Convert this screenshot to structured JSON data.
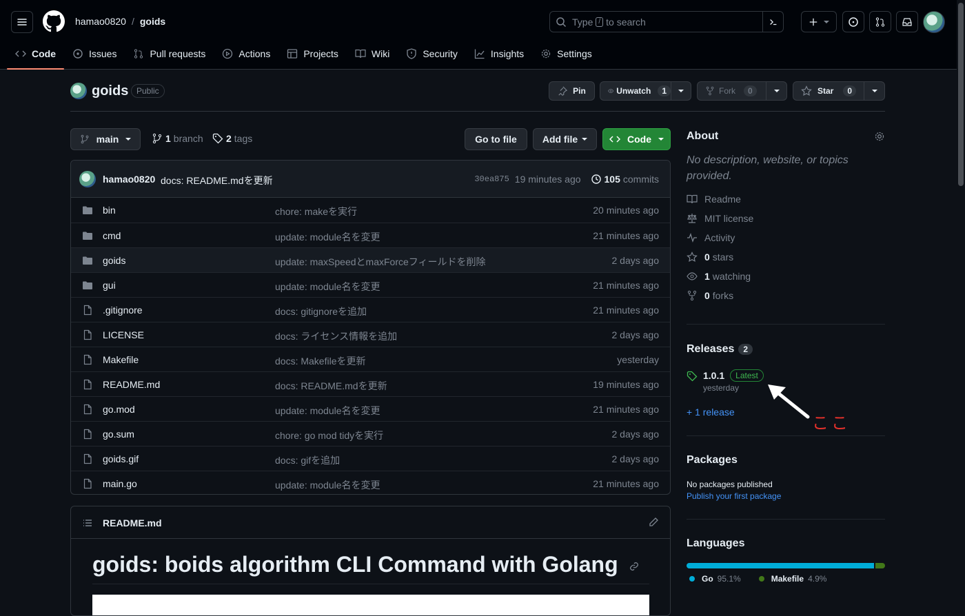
{
  "header": {
    "owner": "hamao0820",
    "separator": "/",
    "repo": "goids",
    "search_text_before": "Type",
    "search_key": "/",
    "search_text_after": "to search"
  },
  "nav": {
    "tabs": [
      {
        "label": "Code",
        "icon": "code-icon",
        "active": true
      },
      {
        "label": "Issues",
        "icon": "issue-icon"
      },
      {
        "label": "Pull requests",
        "icon": "pull-request-icon"
      },
      {
        "label": "Actions",
        "icon": "play-icon"
      },
      {
        "label": "Projects",
        "icon": "table-icon"
      },
      {
        "label": "Wiki",
        "icon": "book-icon"
      },
      {
        "label": "Security",
        "icon": "shield-icon"
      },
      {
        "label": "Insights",
        "icon": "graph-icon"
      },
      {
        "label": "Settings",
        "icon": "gear-icon"
      }
    ]
  },
  "repo": {
    "name": "goids",
    "visibility": "Public",
    "pin_label": "Pin",
    "unwatch_label": "Unwatch",
    "unwatch_count": "1",
    "fork_label": "Fork",
    "fork_count": "0",
    "star_label": "Star",
    "star_count": "0"
  },
  "toolbar": {
    "branch": "main",
    "branch_count": "1",
    "branch_word": "branch",
    "tag_count": "2",
    "tag_word": "tags",
    "go_to_file": "Go to file",
    "add_file": "Add file",
    "code": "Code"
  },
  "commit": {
    "author": "hamao0820",
    "message": "docs: README.mdを更新",
    "sha": "30ea875",
    "time": "19 minutes ago",
    "count": "105",
    "count_word": "commits"
  },
  "files": [
    {
      "name": "bin",
      "type": "dir",
      "message": "chore: makeを実行",
      "date": "20 minutes ago"
    },
    {
      "name": "cmd",
      "type": "dir",
      "message": "update: module名を変更",
      "date": "21 minutes ago"
    },
    {
      "name": "goids",
      "type": "dir",
      "message": "update: maxSpeedとmaxForceフィールドを削除",
      "date": "2 days ago"
    },
    {
      "name": "gui",
      "type": "dir",
      "message": "update: module名を変更",
      "date": "21 minutes ago"
    },
    {
      "name": ".gitignore",
      "type": "file",
      "message": "docs: gitignoreを追加",
      "date": "21 minutes ago"
    },
    {
      "name": "LICENSE",
      "type": "file",
      "message": "docs: ライセンス情報を追加",
      "date": "2 days ago"
    },
    {
      "name": "Makefile",
      "type": "file",
      "message": "docs: Makefileを更新",
      "date": "yesterday"
    },
    {
      "name": "README.md",
      "type": "file",
      "message": "docs: README.mdを更新",
      "date": "19 minutes ago"
    },
    {
      "name": "go.mod",
      "type": "file",
      "message": "update: module名を変更",
      "date": "21 minutes ago"
    },
    {
      "name": "go.sum",
      "type": "file",
      "message": "chore: go mod tidyを実行",
      "date": "2 days ago"
    },
    {
      "name": "goids.gif",
      "type": "file",
      "message": "docs: gifを追加",
      "date": "2 days ago"
    },
    {
      "name": "main.go",
      "type": "file",
      "message": "update: module名を変更",
      "date": "21 minutes ago"
    }
  ],
  "readme": {
    "filename": "README.md",
    "heading": "goids: boids algorithm CLI Command with Golang"
  },
  "about": {
    "title": "About",
    "description": "No description, website, or topics provided.",
    "readme": "Readme",
    "license": "MIT license",
    "activity": "Activity",
    "stars_count": "0",
    "stars_word": "stars",
    "watching_count": "1",
    "watching_word": "watching",
    "forks_count": "0",
    "forks_word": "forks"
  },
  "releases": {
    "title": "Releases",
    "count": "2",
    "latest_version": "1.0.1",
    "latest_badge": "Latest",
    "latest_date": "yesterday",
    "more_link": "+ 1 release",
    "annotation": "ここ"
  },
  "packages": {
    "title": "Packages",
    "empty": "No packages published",
    "publish_link": "Publish your first package"
  },
  "languages": {
    "title": "Languages",
    "items": [
      {
        "name": "Go",
        "percent": "95.1%",
        "share": 95.1,
        "color": "#00add8"
      },
      {
        "name": "Makefile",
        "percent": "4.9%",
        "share": 4.9,
        "color": "#427819"
      }
    ]
  },
  "colors": {
    "accent_tab": "#fd8c73",
    "green_button": "#238636",
    "link": "#4493f8",
    "annotation": "#e5312b"
  }
}
